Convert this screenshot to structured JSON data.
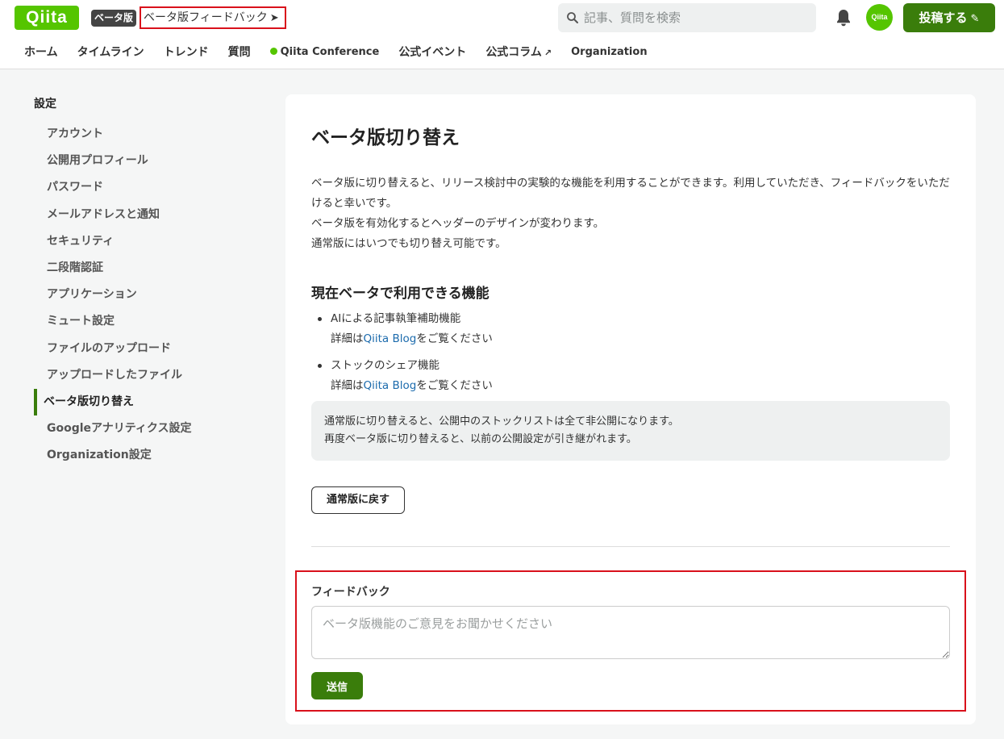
{
  "header": {
    "logo": "Qiita",
    "beta_badge": "ベータ版",
    "beta_feedback": "ベータ版フィードバック",
    "beta_feedback_arrow": "➤",
    "search_placeholder": "記事、質問を検索",
    "avatar_text": "Qiita",
    "post_label": "投稿する",
    "post_icon": "pencil-icon"
  },
  "nav": {
    "items": [
      "ホーム",
      "タイムライン",
      "トレンド",
      "質問",
      "Qiita Conference",
      "公式イベント",
      "公式コラム",
      "Organization"
    ]
  },
  "sidebar": {
    "title": "設定",
    "items": [
      "アカウント",
      "公開用プロフィール",
      "パスワード",
      "メールアドレスと通知",
      "セキュリティ",
      "二段階認証",
      "アプリケーション",
      "ミュート設定",
      "ファイルのアップロード",
      "アップロードしたファイル",
      "ベータ版切り替え",
      "Googleアナリティクス設定",
      "Organization設定"
    ],
    "active_index": 10
  },
  "main": {
    "title": "ベータ版切り替え",
    "desc_line1": "ベータ版に切り替えると、リリース検討中の実験的な機能を利用することができます。利用していただき、フィードバックをいただけると幸いです。",
    "desc_line2": "ベータ版を有効化するとヘッダーのデザインが変わります。",
    "desc_line3": "通常版にはいつでも切り替え可能です。",
    "features_title": "現在ベータで利用できる機能",
    "features": [
      {
        "name": "AIによる記事執筆補助機能",
        "detail_prefix": "詳細は",
        "link": "Qiita Blog",
        "detail_suffix": "をご覧ください"
      },
      {
        "name": "ストックのシェア機能",
        "detail_prefix": "詳細は",
        "link": "Qiita Blog",
        "detail_suffix": "をご覧ください"
      }
    ],
    "notice_line1": "通常版に切り替えると、公開中のストックリストは全て非公開になります。",
    "notice_line2": "再度ベータ版に切り替えると、以前の公開設定が引き継がれます。",
    "revert_button": "通常版に戻す"
  },
  "feedback": {
    "label": "フィードバック",
    "placeholder": "ベータ版機能のご意見をお聞かせください",
    "submit": "送信"
  }
}
